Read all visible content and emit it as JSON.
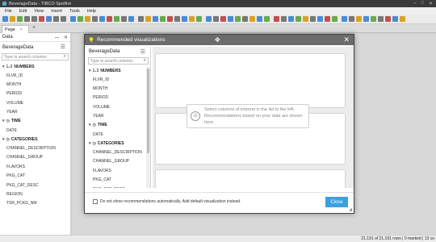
{
  "window": {
    "title": "BeverageData - TIBCO Spotfire",
    "controls": [
      "–",
      "□",
      "✕"
    ]
  },
  "menu": [
    "File",
    "Edit",
    "View",
    "Insert",
    "Tools",
    "Help"
  ],
  "toolbar_colors": [
    "#4a8bd4",
    "#d9a227",
    "#6aa84f",
    "#777777",
    "#777777",
    "#c0504d",
    "#4a8bd4",
    "#777777",
    "#777777",
    "#4a8bd4",
    "#6aa84f",
    "#d9a227",
    "#777777",
    "#4a8bd4",
    "#c0504d",
    "#6aa84f",
    "#777777",
    "#4a8bd4",
    "#777777",
    "#d9a227",
    "#4a8bd4",
    "#6aa84f",
    "#c0504d",
    "#777777",
    "#4a8bd4",
    "#d9a227",
    "#6aa84f",
    "#4a8bd4",
    "#777777",
    "#c0504d",
    "#4a8bd4",
    "#6aa84f",
    "#777777",
    "#d9a227",
    "#4a8bd4",
    "#6aa84f",
    "#c0504d",
    "#777777",
    "#4a8bd4",
    "#6aa84f",
    "#d9a227",
    "#777777",
    "#4a8bd4",
    "#c0504d",
    "#6aa84f",
    "#4a8bd4",
    "#777777",
    "#d9a227",
    "#4a8bd4",
    "#6aa84f",
    "#777777",
    "#c0504d",
    "#4a8bd4",
    "#d9a227"
  ],
  "tabs": {
    "page_label": "Page",
    "close": "×",
    "add": "+"
  },
  "data_panel": {
    "header": "Data",
    "pin": "📌",
    "close": "✕",
    "source": "BeverageData",
    "menu_icon": "☰",
    "search_placeholder": "Type to search columns",
    "groups": [
      {
        "icon": "1₂3",
        "label": "NUMBERS",
        "columns": [
          "FLVR_ID",
          "MONTH",
          "PERIOD",
          "VOLUME",
          "YEAR"
        ]
      },
      {
        "icon": "◷",
        "label": "TIME",
        "columns": [
          "DATE"
        ]
      },
      {
        "icon": "◷",
        "label": "CATEGORIES",
        "columns": [
          "CHANNEL_DESCRIPTION",
          "CHANNEL_GROUP",
          "FLAVORS",
          "PKG_CAT",
          "PKG_CAT_DESC",
          "REGION",
          "TSR_PCKG_NM"
        ]
      }
    ]
  },
  "dialog": {
    "title": "Recommended visualizations",
    "close": "✕",
    "move_icon": "✥",
    "left": {
      "source": "BeverageData",
      "menu_icon": "☰",
      "search_placeholder": "Type to search columns",
      "groups": [
        {
          "icon": "1₂3",
          "label": "NUMBERS",
          "columns": [
            "FLVR_ID",
            "MONTH",
            "PERIOD",
            "VOLUME",
            "YEAR"
          ]
        },
        {
          "icon": "◷",
          "label": "TIME",
          "columns": [
            "DATE"
          ]
        },
        {
          "icon": "◷",
          "label": "CATEGORIES",
          "columns": [
            "CHANNEL_DESCRIPTION",
            "CHANNEL_GROUP",
            "FLAVORS",
            "PKG_CAT",
            "PKG_CAT_DESC"
          ]
        }
      ]
    },
    "hint": {
      "icon": "d",
      "text": "Select columns of interest in the list to the left. Recommendations based on your data are shown here."
    },
    "footer": {
      "checkbox_label": "Do not show recommendations automatically. Add default visualization instead.",
      "checkbox_checked": false,
      "close_button": "Close",
      "close_button_color": "#3ba0df"
    }
  },
  "status": {
    "text": "21,191 of 21,191 rows  |  0 marked  |  13 co"
  }
}
